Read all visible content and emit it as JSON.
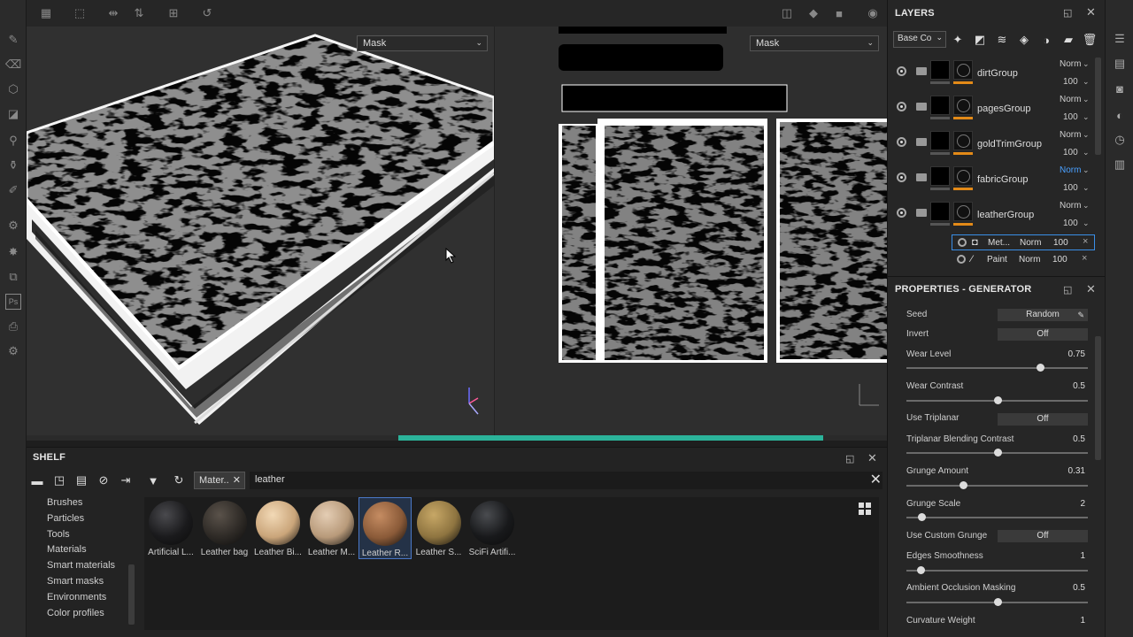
{
  "left_tools": [
    {
      "name": "paint-brush-icon",
      "glyph": "✎"
    },
    {
      "name": "eraser-icon",
      "glyph": "⌫"
    },
    {
      "name": "projection-icon",
      "glyph": "⬡"
    },
    {
      "name": "polygon-fill-icon",
      "glyph": "◪"
    },
    {
      "name": "smudge-icon",
      "glyph": "⚲"
    },
    {
      "name": "clone-stamp-icon",
      "glyph": "⚱"
    },
    {
      "name": "color-picker-icon",
      "glyph": "✐"
    },
    {
      "name": "bake-icon",
      "glyph": "⚙"
    },
    {
      "name": "effects-icon",
      "glyph": "✸"
    },
    {
      "name": "layer-icon",
      "glyph": "⧉"
    },
    {
      "name": "photoshop-icon",
      "glyph": "Ps"
    },
    {
      "name": "export-icon",
      "glyph": "⎙"
    },
    {
      "name": "settings-icon",
      "glyph": "⚙"
    }
  ],
  "top_tools_left": [
    {
      "name": "grid-icon",
      "glyph": "▦"
    },
    {
      "name": "selection-icon",
      "glyph": "⬚"
    },
    {
      "name": "mirror-x-icon",
      "glyph": "⇹"
    },
    {
      "name": "mirror-y-icon",
      "glyph": "⇅"
    },
    {
      "name": "add-icon",
      "glyph": "⊞"
    },
    {
      "name": "history-icon",
      "glyph": "↺"
    }
  ],
  "top_tools_right": [
    {
      "name": "split-view-icon",
      "glyph": "◫"
    },
    {
      "name": "cube-view-icon",
      "glyph": "◆"
    },
    {
      "name": "camera-video-icon",
      "glyph": "■"
    },
    {
      "name": "screenshot-icon",
      "glyph": "◉"
    }
  ],
  "viewport3d": {
    "channel": "Mask"
  },
  "viewport2d": {
    "channel": "Mask"
  },
  "shelf": {
    "title": "SHELF",
    "tag": "Mater..",
    "search": "leather",
    "categories": [
      "Brushes",
      "Particles",
      "Tools",
      "Materials",
      "Smart materials",
      "Smart masks",
      "Environments",
      "Color profiles"
    ],
    "materials": [
      {
        "label": "Artificial L...",
        "color": "#1a1a1c",
        "hi": "#4a4a4e"
      },
      {
        "label": "Leather bag",
        "color": "#2e2a26",
        "hi": "#5a524a"
      },
      {
        "label": "Leather Bi...",
        "color": "#caa57a",
        "hi": "#f2d9b6"
      },
      {
        "label": "Leather M...",
        "color": "#b89a7a",
        "hi": "#e4cdb4"
      },
      {
        "label": "Leather R...",
        "color": "#8a5a38",
        "hi": "#c58c62"
      },
      {
        "label": "Leather S...",
        "color": "#8e7440",
        "hi": "#c7a766"
      },
      {
        "label": "SciFi Artifi...",
        "color": "#18191b",
        "hi": "#4a4c50"
      }
    ]
  },
  "layers": {
    "title": "LAYERS",
    "channel": "Base Co",
    "items": [
      {
        "name": "dirtGroup",
        "blend": "Norm",
        "opacity": "100"
      },
      {
        "name": "pagesGroup",
        "blend": "Norm",
        "opacity": "100"
      },
      {
        "name": "goldTrimGroup",
        "blend": "Norm",
        "opacity": "100"
      },
      {
        "name": "fabricGroup",
        "blend": "Norm",
        "opacity": "100"
      },
      {
        "name": "leatherGroup",
        "blend": "Norm",
        "opacity": "100"
      }
    ],
    "sublayers": [
      {
        "name": "Met...",
        "blend": "Norm",
        "opacity": "100"
      },
      {
        "name": "Paint",
        "blend": "Norm",
        "opacity": "100"
      }
    ]
  },
  "properties": {
    "title": "PROPERTIES - GENERATOR",
    "seed_label": "Seed",
    "seed_value": "Random",
    "invert_label": "Invert",
    "invert_value": "Off",
    "wear_level_label": "Wear Level",
    "wear_level_value": "0.75",
    "wear_contrast_label": "Wear Contrast",
    "wear_contrast_value": "0.5",
    "triplanar_label": "Use Triplanar",
    "triplanar_value": "Off",
    "triplanar_contrast_label": "Triplanar Blending Contrast",
    "triplanar_contrast_value": "0.5",
    "grunge_amount_label": "Grunge Amount",
    "grunge_amount_value": "0.31",
    "grunge_scale_label": "Grunge Scale",
    "grunge_scale_value": "2",
    "custom_grunge_label": "Use Custom Grunge",
    "custom_grunge_value": "Off",
    "edges_label": "Edges Smoothness",
    "edges_value": "1",
    "ao_label": "Ambient Occlusion Masking",
    "ao_value": "0.5",
    "curvature_label": "Curvature Weight",
    "curvature_value": "1"
  },
  "right_strip": [
    {
      "name": "layers-panel-icon",
      "glyph": "☰"
    },
    {
      "name": "texture-set-icon",
      "glyph": "▤"
    },
    {
      "name": "properties-icon",
      "glyph": "◙"
    },
    {
      "name": "display-settings-icon",
      "glyph": "◐"
    },
    {
      "name": "history-panel-icon",
      "glyph": "◷"
    },
    {
      "name": "log-icon",
      "glyph": "▥"
    }
  ]
}
